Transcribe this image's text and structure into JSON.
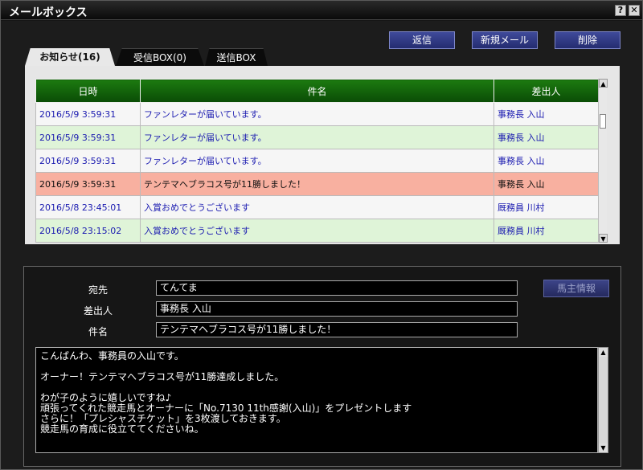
{
  "window": {
    "title": "メールボックス",
    "help_label": "?",
    "close_label": "✕"
  },
  "actions": {
    "reply": "返信",
    "new_mail": "新規メール",
    "delete": "削除"
  },
  "tabs": [
    {
      "label": "お知らせ(16)",
      "active": true
    },
    {
      "label": "受信BOX(0)",
      "active": false
    },
    {
      "label": "送信BOX",
      "active": false
    }
  ],
  "table": {
    "headers": [
      "日時",
      "件名",
      "差出人"
    ],
    "rows": [
      {
        "date": "2016/5/9 3:59:31",
        "subject": "ファンレターが届いています。",
        "sender": "事務長  入山",
        "style": "white"
      },
      {
        "date": "2016/5/9 3:59:31",
        "subject": "ファンレターが届いています。",
        "sender": "事務長  入山",
        "style": "green"
      },
      {
        "date": "2016/5/9 3:59:31",
        "subject": "ファンレターが届いています。",
        "sender": "事務長  入山",
        "style": "white"
      },
      {
        "date": "2016/5/9 3:59:31",
        "subject": "テンテマヘブラコス号が11勝しました！",
        "sender": "事務長  入山",
        "style": "selected"
      },
      {
        "date": "2016/5/8 23:45:01",
        "subject": "入賞おめでとうございます",
        "sender": "厩務員  川村",
        "style": "white"
      },
      {
        "date": "2016/5/8 23:15:02",
        "subject": "入賞おめでとうございます",
        "sender": "厩務員  川村",
        "style": "green"
      }
    ]
  },
  "detail": {
    "to_label": "宛先",
    "to_value": "てんてま",
    "from_label": "差出人",
    "from_value": "事務長  入山",
    "subject_label": "件名",
    "subject_value": "テンテマヘブラコス号が11勝しました！",
    "owner_button": "馬主情報",
    "body": "こんばんわ、事務員の入山です。\n\nオーナー！テンテマヘブラコス号が11勝達成しました。\n\nわが子のように嬉しいですね♪\n頑張ってくれた競走馬とオーナーに「No.7130 11th感謝(入山)」をプレゼントします\nさらに！「プレシャスチケット」を3枚渡しておきます。\n競走馬の育成に役立ててくださいね。"
  },
  "scroll_arrows": {
    "up": "▲",
    "down": "▼"
  },
  "colors": {
    "header_green": "#0a4c05",
    "selected_row": "#f8b0a0",
    "alt_row": "#dff4d8",
    "button_blue": "#2c3480"
  }
}
